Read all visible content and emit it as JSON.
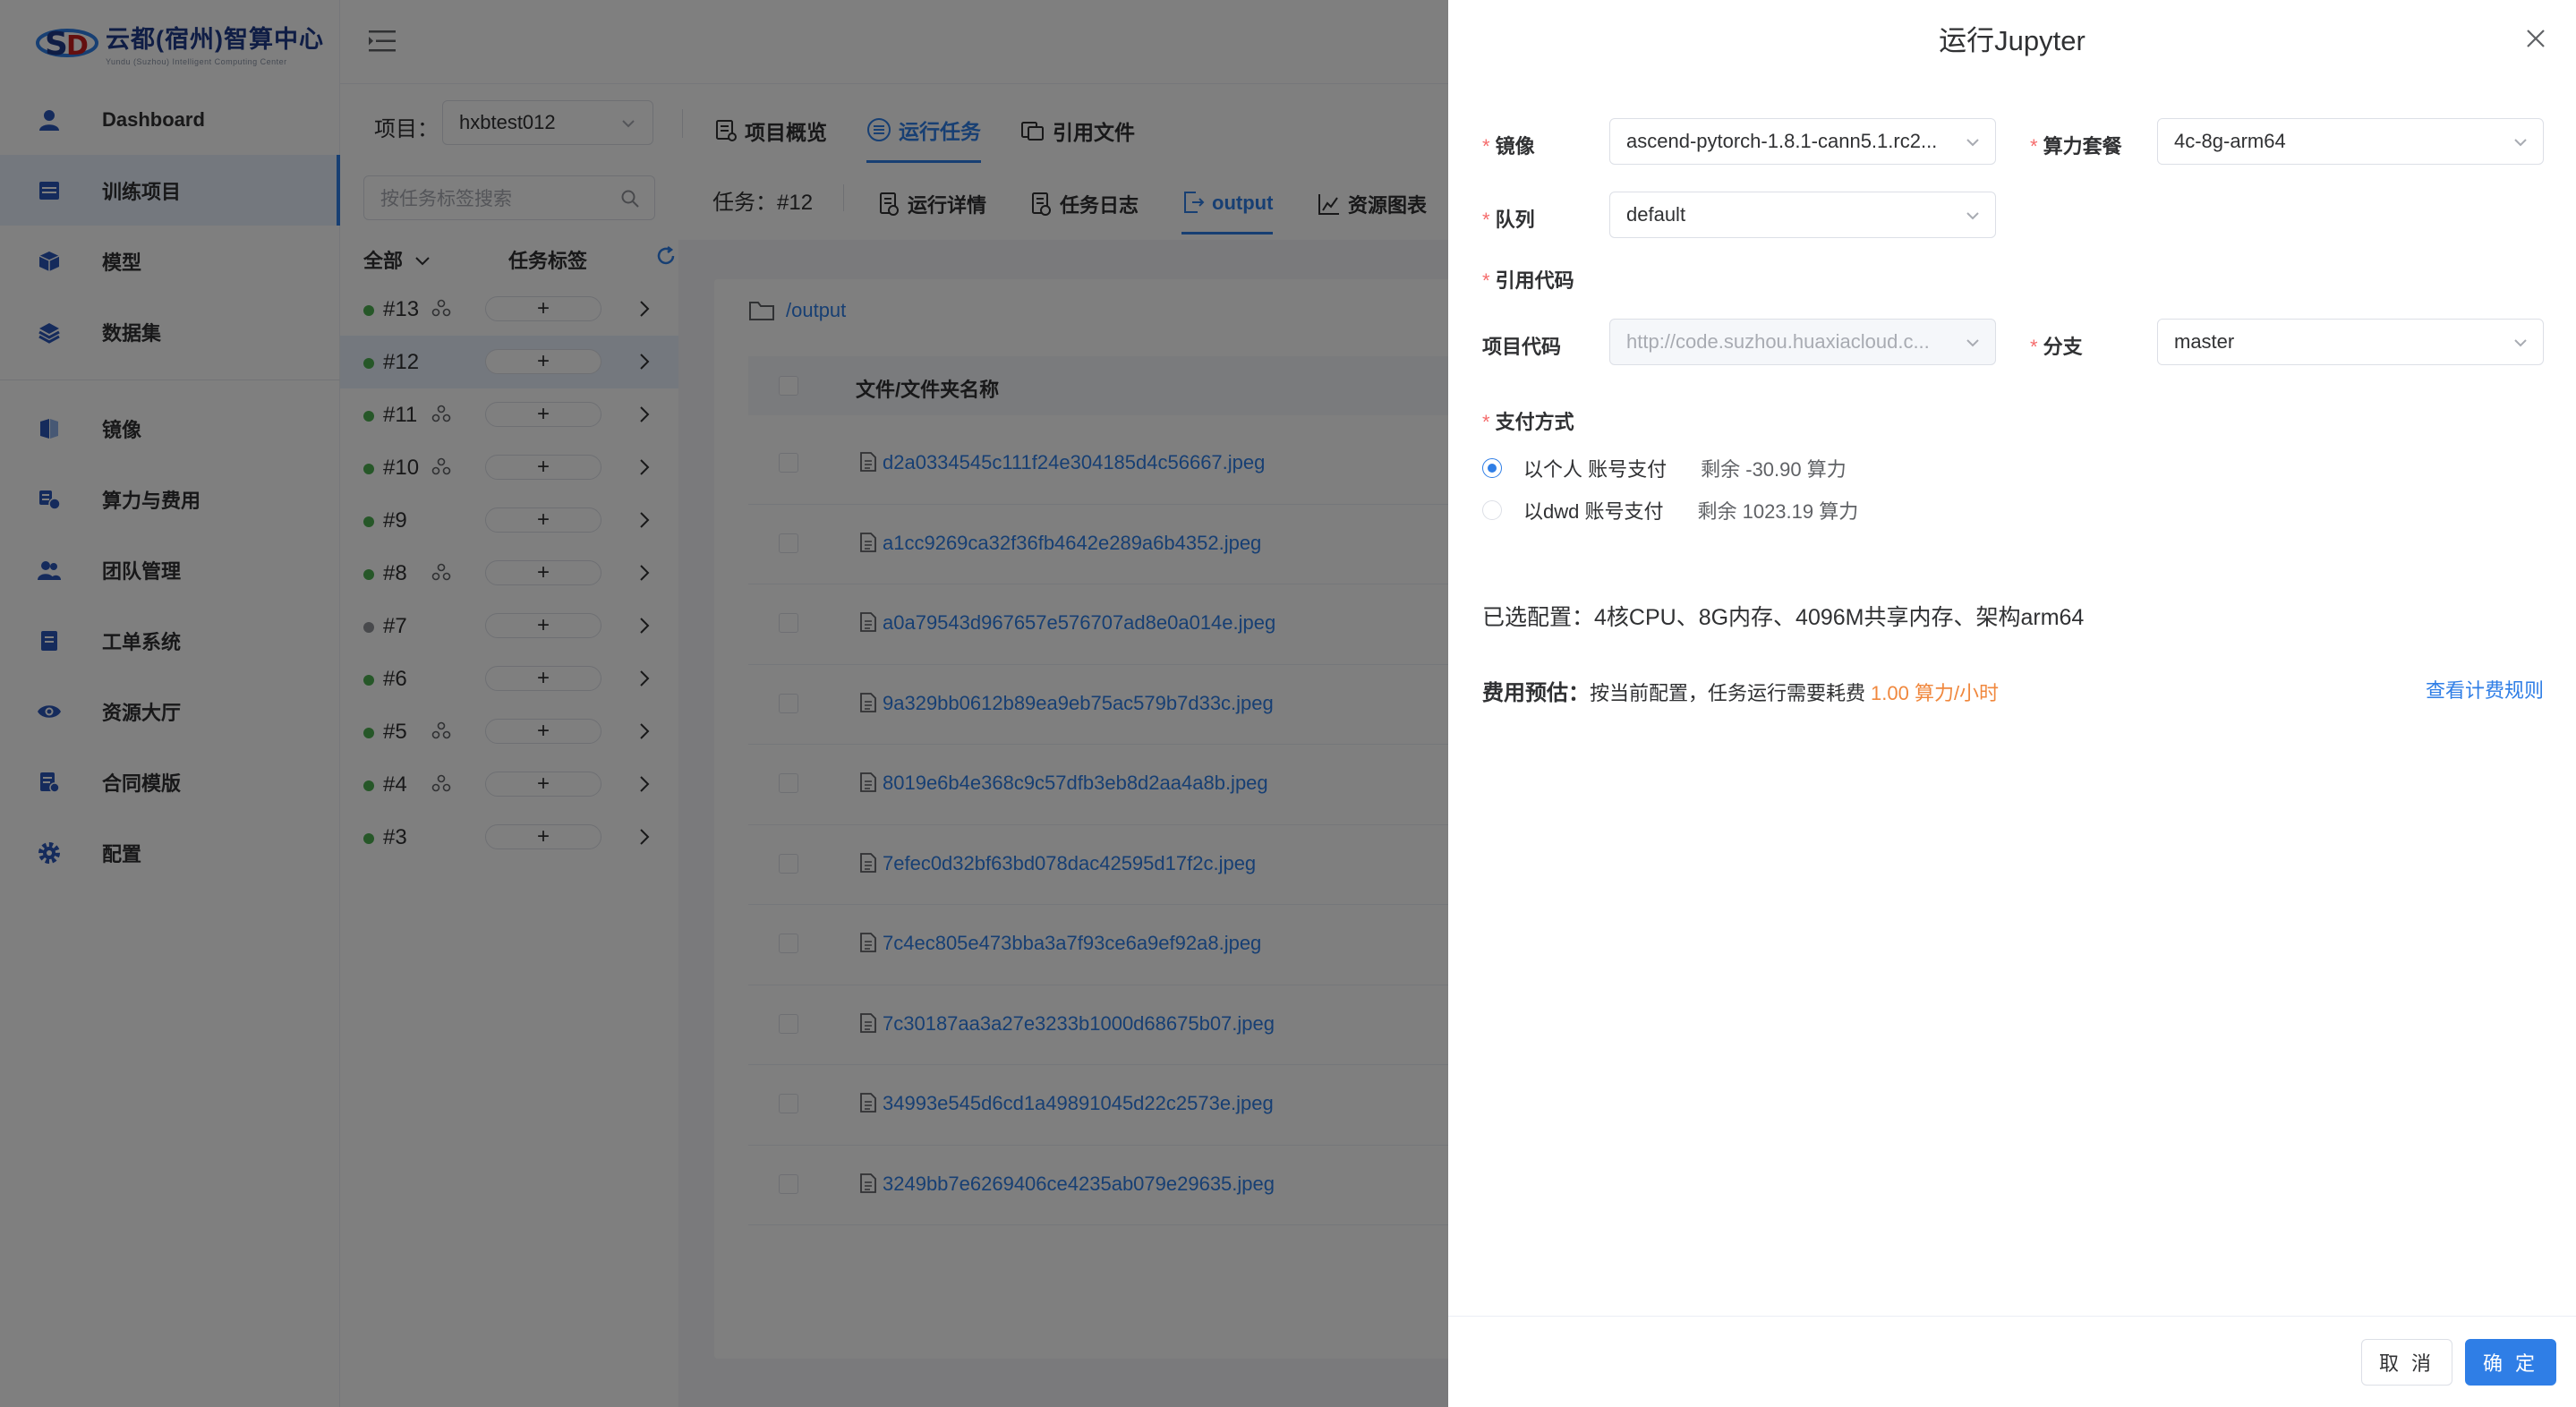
{
  "brand": {
    "name_cn": "云都(宿州)智算中心",
    "name_en": "Yundu (Suzhou) Intelligent Computing Center"
  },
  "sidebar": {
    "items": [
      {
        "label": "Dashboard",
        "icon": "user-icon"
      },
      {
        "label": "训练项目",
        "icon": "project-icon",
        "active": true
      },
      {
        "label": "模型",
        "icon": "cube-icon"
      },
      {
        "label": "数据集",
        "icon": "layers-icon"
      },
      {
        "label": "镜像",
        "icon": "image-icon"
      },
      {
        "label": "算力与费用",
        "icon": "compute-fee-icon"
      },
      {
        "label": "团队管理",
        "icon": "team-icon"
      },
      {
        "label": "工单系统",
        "icon": "ticket-icon"
      },
      {
        "label": "资源大厅",
        "icon": "eye-icon"
      },
      {
        "label": "合同模版",
        "icon": "contract-icon"
      },
      {
        "label": "配置",
        "icon": "gear-icon"
      }
    ]
  },
  "project": {
    "label": "项目：",
    "value": "hxbtest012"
  },
  "top_tabs": [
    {
      "label": "项目概览"
    },
    {
      "label": "运行任务",
      "active": true
    },
    {
      "label": "引用文件"
    }
  ],
  "tasks": {
    "search_placeholder": "按任务标签搜索",
    "filter_all": "全部",
    "tag_header": "任务标签",
    "add_symbol": "+",
    "items": [
      {
        "id": "#13",
        "status": "green",
        "node": true
      },
      {
        "id": "#12",
        "status": "green",
        "node": false,
        "active": true
      },
      {
        "id": "#11",
        "status": "green",
        "node": true
      },
      {
        "id": "#10",
        "status": "green",
        "node": true
      },
      {
        "id": "#9",
        "status": "green",
        "node": false
      },
      {
        "id": "#8",
        "status": "green",
        "node": true
      },
      {
        "id": "#7",
        "status": "grey",
        "node": false
      },
      {
        "id": "#6",
        "status": "green",
        "node": false
      },
      {
        "id": "#5",
        "status": "green",
        "node": true
      },
      {
        "id": "#4",
        "status": "green",
        "node": true
      },
      {
        "id": "#3",
        "status": "green",
        "node": false
      }
    ]
  },
  "detail": {
    "task_no": "任务：#12",
    "tabs": [
      {
        "label": "运行详情"
      },
      {
        "label": "任务日志"
      },
      {
        "label": "output",
        "active": true
      },
      {
        "label": "资源图表"
      }
    ],
    "path": "/output",
    "column_name": "文件/文件夹名称",
    "files": [
      "d2a0334545c111f24e304185d4c56667.jpeg",
      "a1cc9269ca32f36fb4642e289a6b4352.jpeg",
      "a0a79543d967657e576707ad8e0a014e.jpeg",
      "9a329bb0612b89ea9eb75ac579b7d33c.jpeg",
      "8019e6b4e368c9c57dfb3eb8d2aa4a8b.jpeg",
      "7efec0d32bf63bd078dac42595d17f2c.jpeg",
      "7c4ec805e473bba3a7f93ce6a9ef92a8.jpeg",
      "7c30187aa3a27e3233b1000d68675b07.jpeg",
      "34993e545d6cd1a49891045d22c2573e.jpeg",
      "3249bb7e6269406ce4235ab079e29635.jpeg"
    ]
  },
  "drawer": {
    "title": "运行Jupyter",
    "image_label": "镜像",
    "image_value": "ascend-pytorch-1.8.1-cann5.1.rc2...",
    "package_label": "算力套餐",
    "package_value": "4c-8g-arm64",
    "queue_label": "队列",
    "queue_value": "default",
    "code_ref_label": "引用代码",
    "project_code_label": "项目代码",
    "project_code_value": "http://code.suzhou.huaxiacloud.c...",
    "branch_label": "分支",
    "branch_value": "master",
    "payment_label": "支付方式",
    "payments": [
      {
        "label": "以个人 账号支付",
        "remaining": "剩余 -30.90 算力",
        "selected": true
      },
      {
        "label": "以dwd 账号支付",
        "remaining": "剩余 1023.19 算力",
        "selected": false
      }
    ],
    "config_text": "已选配置：4核CPU、8G内存、4096M共享内存、架构arm64",
    "fee_label": "费用预估：",
    "fee_text": "按当前配置，任务运行需要耗费",
    "fee_value": "1.00 算力/小时",
    "fee_rule_link": "查看计费规则",
    "cancel_label": "取 消",
    "ok_label": "确 定"
  },
  "colors": {
    "primary": "#2f7ee6",
    "success": "#4caf50",
    "warning": "#f0883e",
    "danger": "#f56c6c",
    "overlay": "rgba(0,0,0,0.5)"
  }
}
